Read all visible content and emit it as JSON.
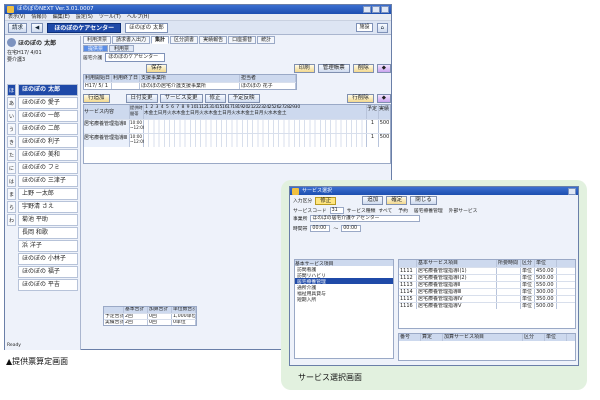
{
  "main_window": {
    "title": "ほのぼのNEXT  Ver.3.01.0007",
    "menu": [
      "表示(V)",
      "情報(I)",
      "編集(E)",
      "設定(S)",
      "ツール(T)",
      "ヘルプ(H)"
    ],
    "toolbar": {
      "billing_button": "請求",
      "office_name": "ほのぼのケアセンター",
      "user_name": "ほのぼの 太郎",
      "facility_select": "施設"
    },
    "client_header": {
      "client_name": "ほのぼの 太郎",
      "info_line1": "在宅H17/ 4/01",
      "info_line2": "要介護3"
    },
    "kana_index": [
      "ほ",
      "あ",
      "い",
      "う",
      "き",
      "た",
      "に",
      "は",
      "ま",
      "ら",
      "わ"
    ],
    "clients": [
      "ほのぼの 太郎",
      "ほのぼの 愛子",
      "ほのぼの 一郎",
      "ほのぼの 二郎",
      "ほのぼの 利子",
      "ほのぼの 美和",
      "ほのぼの フミ",
      "ほのぼの 三津子",
      "上野 一太郎",
      "宇野清 さえ",
      "菊池 平助",
      "長岡 和歌",
      "浜 洋子",
      "ほのぼの 小林子",
      "ほのぼの 福子",
      "ほのぼの 平吉"
    ],
    "tabs": [
      "利用済票",
      "請求書入出力",
      "集計",
      "区分調書",
      "実績報告",
      "口座振替",
      "統計"
    ],
    "sub_tabs": [
      "提供票",
      "利用票"
    ],
    "office_label": "居宅介護",
    "save_button": "保存",
    "print_button": "印刷",
    "management_button": "管理帳票",
    "delete_button": "削除",
    "plan_headers": [
      "利用開始日",
      "利用終了日",
      "支援事業所",
      "担当者"
    ],
    "plan_row": [
      "H17/ 5/ 1",
      "",
      "ほのぼの居宅介護支援事業所",
      "ほのぼの 花子"
    ],
    "row_add_button": "行追加",
    "row_delete_button": "行削除",
    "action_buttons": [
      "日付変更",
      "サービス変更",
      "修正",
      "予定反映"
    ],
    "service_headers": [
      "サービス内容",
      "提供時間帯"
    ],
    "days_label": "日付",
    "days": [
      "1",
      "2",
      "3",
      "4",
      "5",
      "6",
      "7",
      "8",
      "9",
      "10",
      "11",
      "12",
      "13",
      "14",
      "15",
      "16",
      "17",
      "18",
      "19",
      "20",
      "21",
      "22",
      "23",
      "24",
      "25",
      "26",
      "27",
      "28",
      "29",
      "30"
    ],
    "weekday_row": "木金土日月火水木金土日月火水木金土日月火水木金土日月火水木金土",
    "count_headers": [
      "予定",
      "実績"
    ],
    "service_rows": [
      {
        "name": "居宅療養管理指導Ⅱ",
        "time_start": "10:00",
        "time_end": "~12:00",
        "plan_count": "1",
        "result_count": "1",
        "amount": "500"
      },
      {
        "name": "居宅療養管理指導Ⅲ",
        "time_start": "10:00",
        "time_end": "~12:00",
        "plan_count": "1",
        "result_count": "1",
        "amount": "500"
      }
    ],
    "totals": {
      "headers": [
        "基本合計",
        "加算合計",
        "単位数合計"
      ],
      "rows": [
        {
          "label": "予定合計",
          "values": [
            "2回",
            "0回",
            "1,000単位"
          ]
        },
        {
          "label": "実績合計",
          "values": [
            "2回",
            "0回",
            "0単位"
          ]
        }
      ]
    },
    "status_text": "Ready"
  },
  "caption_left": "▲提供票算定画面",
  "service_window": {
    "title": "サービス選択",
    "input_category": "入力区分",
    "mode_label": "修正",
    "buttons": [
      "追加",
      "確定",
      "閉じる"
    ],
    "service_code_label": "サービスコード",
    "service_code_value": "31",
    "service_type_label": "サービス種類",
    "filter_options": [
      "すべて",
      "予約",
      "居宅療養管理",
      "外部サービス"
    ],
    "office_label": "事業所",
    "office_value": "ほのぼの居宅介護ケアセンター",
    "time_label": "時間帯",
    "time_start": "00:00",
    "time_end": "00:00",
    "list_header": "基本サービス項目",
    "list_columns": [
      "基本サービス項目",
      "所要時間",
      "区分",
      "単位"
    ],
    "left_list": [
      "訪問看護",
      "訪問リハビリ",
      "居宅療養管理",
      "通所介護",
      "福祉用具貸与",
      "短期入所"
    ],
    "service_items": [
      {
        "code": "1111",
        "name": "居宅療養管理指導Ⅰ(1)",
        "unit": "単位",
        "value": "450.00"
      },
      {
        "code": "1112",
        "name": "居宅療養管理指導Ⅰ(2)",
        "unit": "単位",
        "value": "500.00"
      },
      {
        "code": "1113",
        "name": "居宅療養管理指導Ⅱ",
        "unit": "単位",
        "value": "550.00"
      },
      {
        "code": "1114",
        "name": "居宅療養管理指導Ⅲ",
        "unit": "単位",
        "value": "300.00"
      },
      {
        "code": "1115",
        "name": "居宅療養管理指導Ⅳ",
        "unit": "単位",
        "value": "350.00"
      },
      {
        "code": "1116",
        "name": "居宅療養管理指導Ⅴ",
        "unit": "単位",
        "value": "500.00"
      }
    ],
    "addition_columns": [
      "番号",
      "算定",
      "加算サービス項目",
      "区分",
      "単位"
    ]
  },
  "caption_right": "サービス選択画面"
}
